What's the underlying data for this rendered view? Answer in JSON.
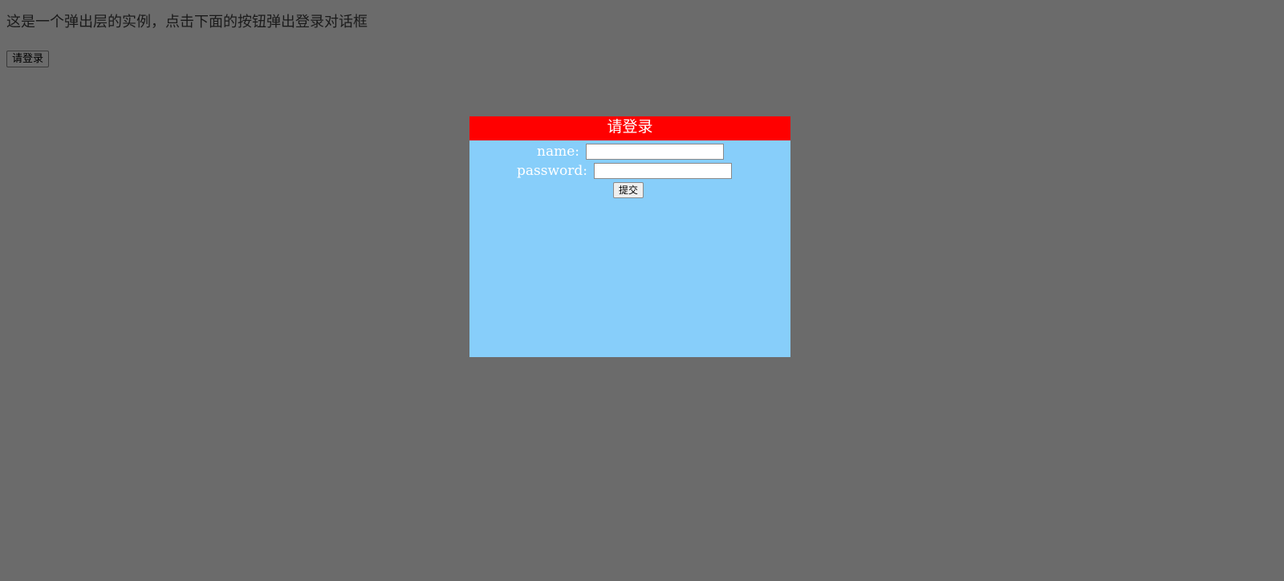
{
  "intro": {
    "text": "这是一个弹出层的实例，点击下面的按钮弹出登录对话框"
  },
  "open_login_button": {
    "label": "请登录"
  },
  "dialog": {
    "title": "请登录",
    "name_label": "name:",
    "name_value": "",
    "password_label": "password:",
    "password_value": "",
    "submit_label": "提交"
  },
  "colors": {
    "page_background": "#6b6b6b",
    "dialog_header": "#ff0000",
    "dialog_body": "#87cefa",
    "dialog_text": "#ffffff"
  }
}
